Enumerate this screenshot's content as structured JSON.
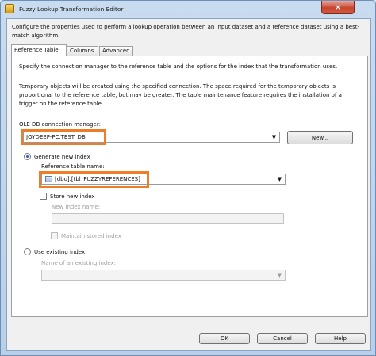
{
  "window": {
    "title": "Fuzzy Lookup Transformation Editor",
    "close_label": "✕"
  },
  "description": "Configure the properties used to perform a lookup operation between an input dataset and a reference dataset using a best-match algorithm.",
  "tabs": [
    {
      "label": "Reference Table",
      "active": true
    },
    {
      "label": "Columns",
      "active": false
    },
    {
      "label": "Advanced",
      "active": false
    }
  ],
  "reference_table": {
    "intro": "Specify the connection manager to the reference table and the options for the index that the transformation uses.",
    "temp_note": "Temporary objects will be created using the specified connection. The space required for the temporary objects is proportional to the reference table, but may be greater. The table maintenance feature requires the installation of a trigger on the reference table.",
    "connection_label": "OLE DB connection manager:",
    "connection_value": "JOYDEEP-PC.TEST_DB",
    "new_button": "New...",
    "generate_index": {
      "label": "Generate new index",
      "selected": true,
      "table_label": "Reference table name:",
      "table_value": "[dbo].[tbl_FUZZYREFERENCES]",
      "store_label": "Store new index",
      "store_checked": false,
      "new_index_label": "New index name:",
      "new_index_value": "",
      "maintain_label": "Maintain stored index",
      "maintain_checked": false
    },
    "existing_index": {
      "label": "Use existing index",
      "selected": false,
      "name_label": "Name of an existing index:",
      "name_value": ""
    }
  },
  "footer": {
    "ok": "OK",
    "cancel": "Cancel",
    "help": "Help"
  },
  "colors": {
    "highlight": "#ef7d28",
    "radio_selected": "#2b5fa8"
  },
  "icons": [
    "app-icon",
    "close-icon",
    "dropdown-arrow-icon",
    "table-icon"
  ]
}
